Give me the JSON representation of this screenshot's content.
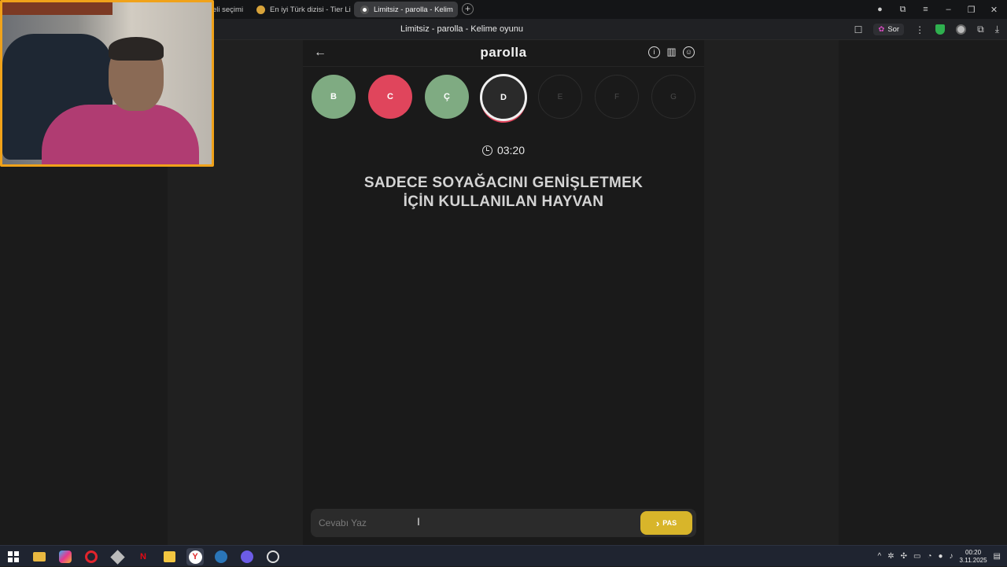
{
  "browser": {
    "tabs": [
      {
        "label": "eli seçimi",
        "active": false
      },
      {
        "label": "En iyi Türk dizisi - Tier List",
        "active": false
      },
      {
        "label": "Limitsiz - parolla - Kelim",
        "active": true
      }
    ],
    "tab_close": "×",
    "new_tab": "+",
    "page_title": "Limitsiz - parolla - Kelime oyunu",
    "sor_label": "Sor",
    "window_controls": [
      "–",
      "❐",
      "✕"
    ],
    "toolbar_glyphs": {
      "bookmark": "☐",
      "more": "⋮",
      "download": "⤓",
      "account": "●",
      "restore": "⧉",
      "menu": "≡"
    }
  },
  "app": {
    "logo": "parolla",
    "back_glyph": "←",
    "header_icons": {
      "info": "i",
      "stats": "▥",
      "profile": "☺"
    },
    "letters": [
      {
        "letter": "B",
        "state": "correct"
      },
      {
        "letter": "C",
        "state": "wrong"
      },
      {
        "letter": "Ç",
        "state": "correct"
      },
      {
        "letter": "D",
        "state": "current"
      },
      {
        "letter": "E",
        "state": "future"
      },
      {
        "letter": "F",
        "state": "future"
      },
      {
        "letter": "G",
        "state": "future"
      }
    ],
    "timer": "03:20",
    "question_line1": "SADECE SOYAĞACINI GENİŞLETMEK",
    "question_line2": "İÇİN KULLANILAN HAYVAN",
    "answer_placeholder": "Cevabı Yaz",
    "pass_label": "PAS",
    "pass_glyph": "›"
  },
  "colors": {
    "correct": "#7fab82",
    "wrong": "#e0455c",
    "pass_button": "#d8b52a",
    "background": "#1a1a1a"
  },
  "taskbar": {
    "icons": [
      "windows-start",
      "file-explorer",
      "copilot",
      "opera",
      "app-generic",
      "netflix",
      "store",
      "yandex-browser",
      "steam",
      "app-chat",
      "app-timer"
    ],
    "time": "00:20",
    "date": "3.11.2025"
  }
}
